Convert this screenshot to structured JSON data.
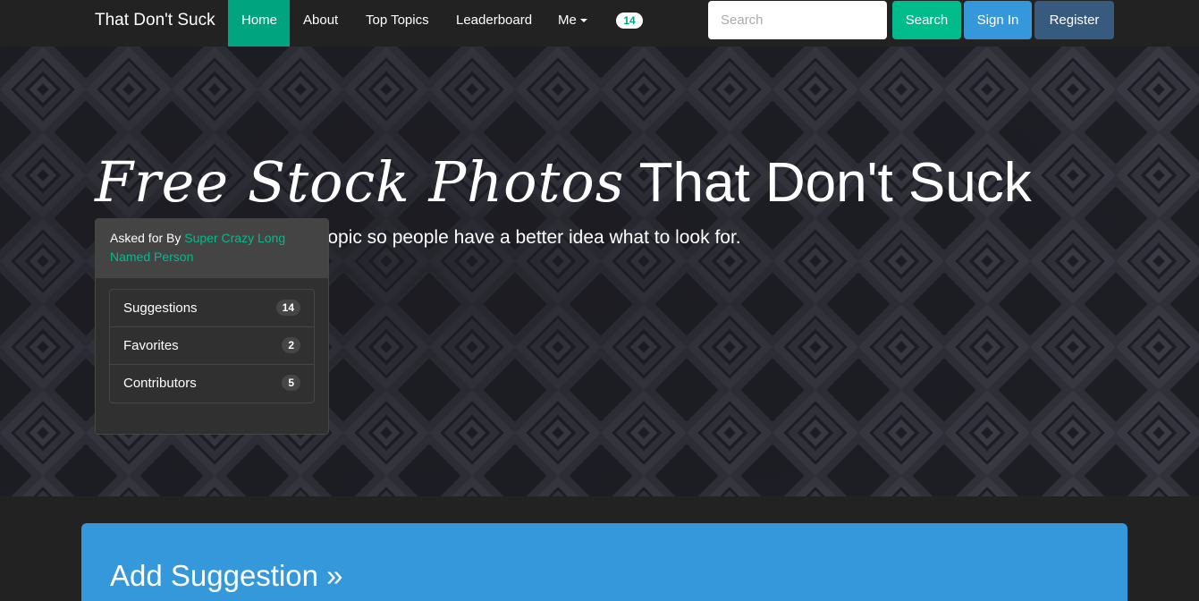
{
  "navbar": {
    "brand": "That Don't Suck",
    "items": [
      {
        "label": "Home",
        "active": true
      },
      {
        "label": "About"
      },
      {
        "label": "Top Topics"
      },
      {
        "label": "Leaderboard"
      },
      {
        "label": "Me",
        "dropdown": true
      }
    ],
    "badge": "14",
    "search_placeholder": "Search",
    "search_button": "Search",
    "signin_button": "Sign In",
    "register_button": "Register"
  },
  "hero": {
    "title_script": "Free Stock Photos",
    "title_plain": "That Don't Suck",
    "subtitle": "Optional sub description of topic so people have a better idea what to look for."
  },
  "panel": {
    "asked_for_by": "Asked for By",
    "author": "Super Crazy Long Named Person",
    "stats": [
      {
        "label": "Suggestions",
        "count": "14"
      },
      {
        "label": "Favorites",
        "count": "2"
      },
      {
        "label": "Contributors",
        "count": "5"
      }
    ]
  },
  "jumbotron": {
    "title": "Add Suggestion »"
  },
  "colors": {
    "navbar_bg": "#222222",
    "active_green": "#00a57f",
    "accent_green": "#00bc8c",
    "info_blue": "#3498db",
    "primary_navy": "#375a7f",
    "panel_bg": "#303030"
  }
}
